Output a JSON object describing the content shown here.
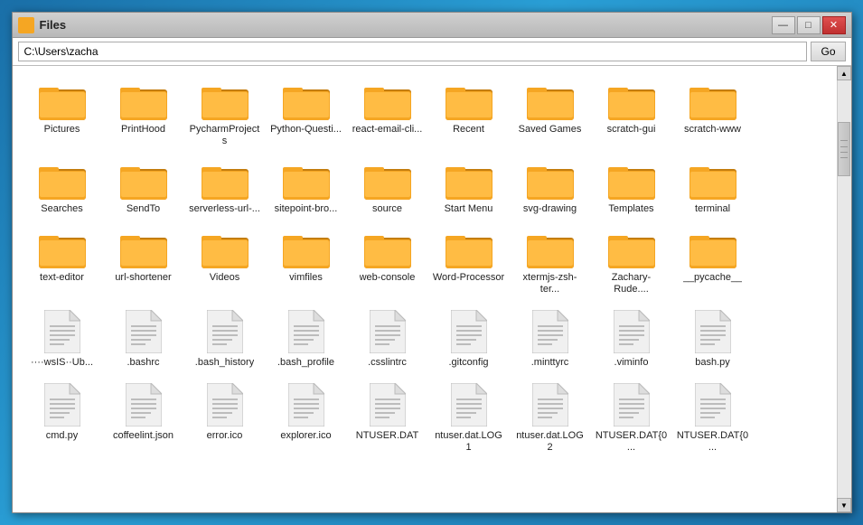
{
  "window": {
    "title": "Files",
    "address": "C:\\Users\\zacha",
    "go_label": "Go",
    "minimize_label": "—",
    "maximize_label": "□",
    "close_label": "✕"
  },
  "folders": [
    {
      "name": "Pictures"
    },
    {
      "name": "PrintHood"
    },
    {
      "name": "PycharmProjects"
    },
    {
      "name": "Python-Questi..."
    },
    {
      "name": "react-email-cli..."
    },
    {
      "name": "Recent"
    },
    {
      "name": "Saved Games"
    },
    {
      "name": "scratch-gui"
    },
    {
      "name": "scratch-www"
    },
    {
      "name": "Searches"
    },
    {
      "name": "SendTo"
    },
    {
      "name": "serverless-url-..."
    },
    {
      "name": "sitepoint-bro..."
    },
    {
      "name": "source"
    },
    {
      "name": "Start Menu"
    },
    {
      "name": "svg-drawing"
    },
    {
      "name": "Templates"
    },
    {
      "name": "terminal"
    },
    {
      "name": "text-editor"
    },
    {
      "name": "url-shortener"
    },
    {
      "name": "Videos"
    },
    {
      "name": "vimfiles"
    },
    {
      "name": "web-console"
    },
    {
      "name": "Word-Processor"
    },
    {
      "name": "xtermjs-zsh-ter..."
    },
    {
      "name": "Zachary-Rude...."
    },
    {
      "name": "__pycache__"
    }
  ],
  "files": [
    {
      "name": "····wsIS··Ub..."
    },
    {
      "name": ".bashrc"
    },
    {
      "name": ".bash_history"
    },
    {
      "name": ".bash_profile"
    },
    {
      "name": ".csslintrc"
    },
    {
      "name": ".gitconfig"
    },
    {
      "name": ".minttyrc"
    },
    {
      "name": ".viminfo"
    },
    {
      "name": "bash.py"
    },
    {
      "name": "cmd.py"
    },
    {
      "name": "coffeelint.json"
    },
    {
      "name": "error.ico"
    },
    {
      "name": "explorer.ico"
    },
    {
      "name": "NTUSER.DAT"
    },
    {
      "name": "ntuser.dat.LOG1"
    },
    {
      "name": "ntuser.dat.LOG2"
    },
    {
      "name": "NTUSER.DAT{0..."
    },
    {
      "name": "NTUSER.DAT{0..."
    }
  ],
  "icons": {
    "folder_color": "#F5A623",
    "folder_shadow": "#C47D0E",
    "doc_color": "#e8e8e8",
    "doc_border": "#aaaaaa",
    "doc_lines": "#888888"
  }
}
